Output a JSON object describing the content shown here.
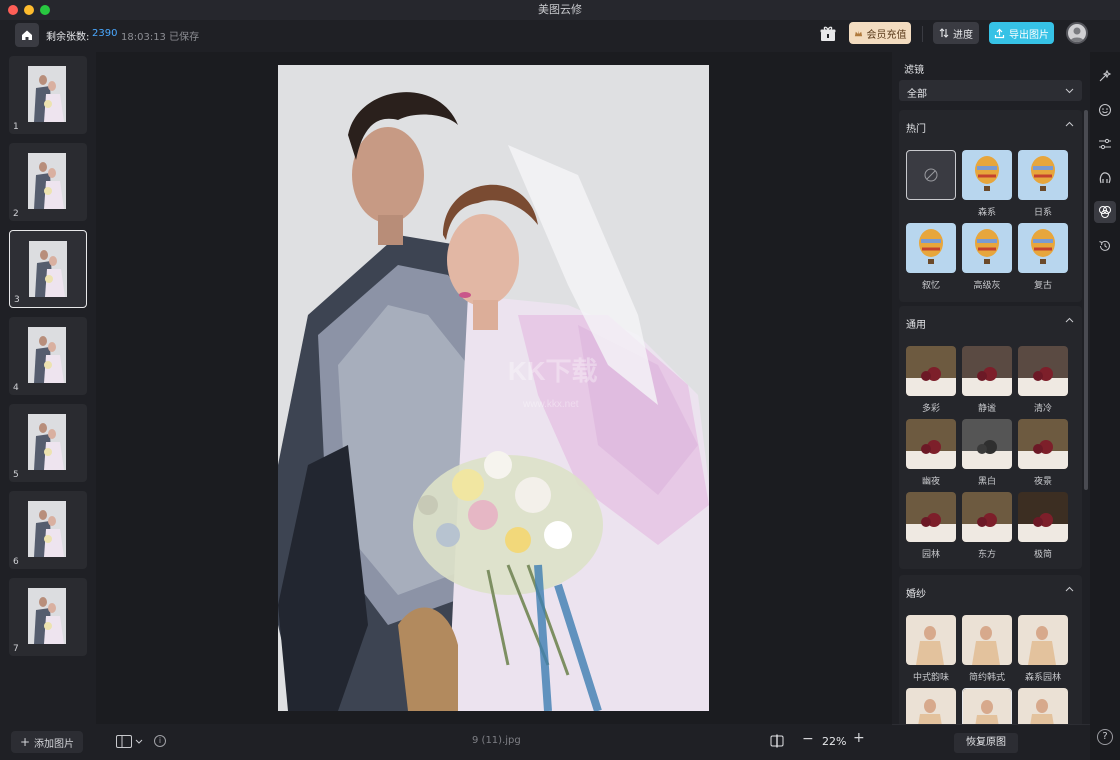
{
  "app": {
    "title": "美图云修"
  },
  "toolbar": {
    "remaining_label": "剩余张数:",
    "remaining_count": "2390",
    "save_status": "18:03:13 已保存",
    "vip_label": "会员充值",
    "progress_label": "进度",
    "export_label": "导出图片"
  },
  "thumbnails": [
    {
      "number": "1",
      "selected": false
    },
    {
      "number": "2",
      "selected": false
    },
    {
      "number": "3",
      "selected": true
    },
    {
      "number": "4",
      "selected": false
    },
    {
      "number": "5",
      "selected": false
    },
    {
      "number": "6",
      "selected": false
    },
    {
      "number": "7",
      "selected": false
    }
  ],
  "left_panel": {
    "add_label": "添加图片"
  },
  "bottom_bar": {
    "filename": "9 (11).jpg",
    "zoom": "22%"
  },
  "filters": {
    "title": "滤镜",
    "dropdown_value": "全部",
    "sections": [
      {
        "title": "热门",
        "items": [
          "",
          "森系",
          "日系",
          "叙忆",
          "高级灰",
          "复古"
        ]
      },
      {
        "title": "通用",
        "items": [
          "多彩",
          "静谧",
          "清冷",
          "幽夜",
          "黑白",
          "夜景",
          "园林",
          "东方",
          "极简"
        ]
      },
      {
        "title": "婚纱",
        "items": [
          "中式韵味",
          "简约韩式",
          "森系园林"
        ]
      }
    ],
    "restore_label": "恢复原图"
  },
  "watermark": {
    "text": "KK下载",
    "sub": "www.kkx.net"
  },
  "icons": {
    "traffic_lights": [
      "close-dot",
      "minimize-dot",
      "zoom-dot"
    ],
    "rail": [
      "magic-wand-icon",
      "face-icon",
      "sliders-icon",
      "hair-icon",
      "filter-icon",
      "history-icon"
    ]
  },
  "colors": {
    "accent": "#4aa8ff",
    "export_button": "#36c2e6",
    "vip_button": "#f3dcc0",
    "progress_button": "#3a3b42"
  }
}
